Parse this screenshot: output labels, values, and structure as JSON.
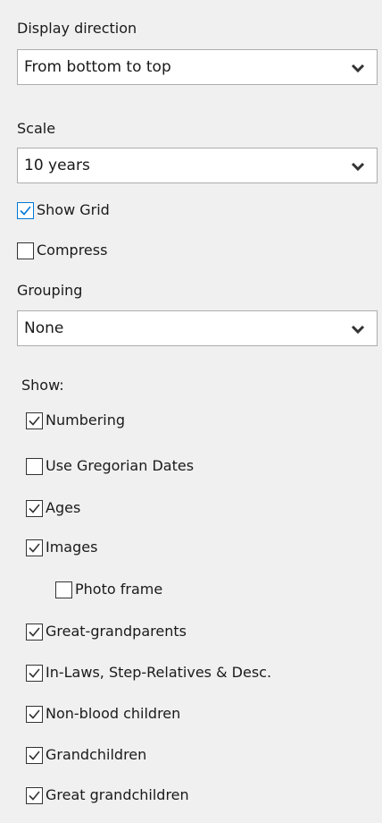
{
  "display_direction": {
    "label": "Display direction",
    "value": "From bottom to top",
    "icon": "chevron-down-icon"
  },
  "scale": {
    "label": "Scale",
    "value": "10 years",
    "icon": "chevron-down-icon"
  },
  "show_grid": {
    "label": "Show Grid",
    "checked": true
  },
  "compress": {
    "label": "Compress",
    "checked": false
  },
  "grouping": {
    "label": "Grouping",
    "value": "None",
    "icon": "chevron-down-icon"
  },
  "show": {
    "heading": "Show:",
    "items": [
      {
        "label": "Numbering",
        "checked": true
      },
      {
        "label": "Use Gregorian Dates",
        "checked": false
      },
      {
        "label": "Ages",
        "checked": true
      },
      {
        "label": "Images",
        "checked": true
      },
      {
        "label": "Photo frame",
        "checked": false
      },
      {
        "label": "Great-grandparents",
        "checked": true
      },
      {
        "label": "In-Laws, Step-Relatives & Desc.",
        "checked": true
      },
      {
        "label": "Non-blood children",
        "checked": true
      },
      {
        "label": "Grandchildren",
        "checked": true
      },
      {
        "label": "Great grandchildren",
        "checked": true
      }
    ]
  },
  "colors": {
    "background": "#f0f0f0",
    "focus_blue": "#0078d7",
    "border": "#adadad"
  }
}
